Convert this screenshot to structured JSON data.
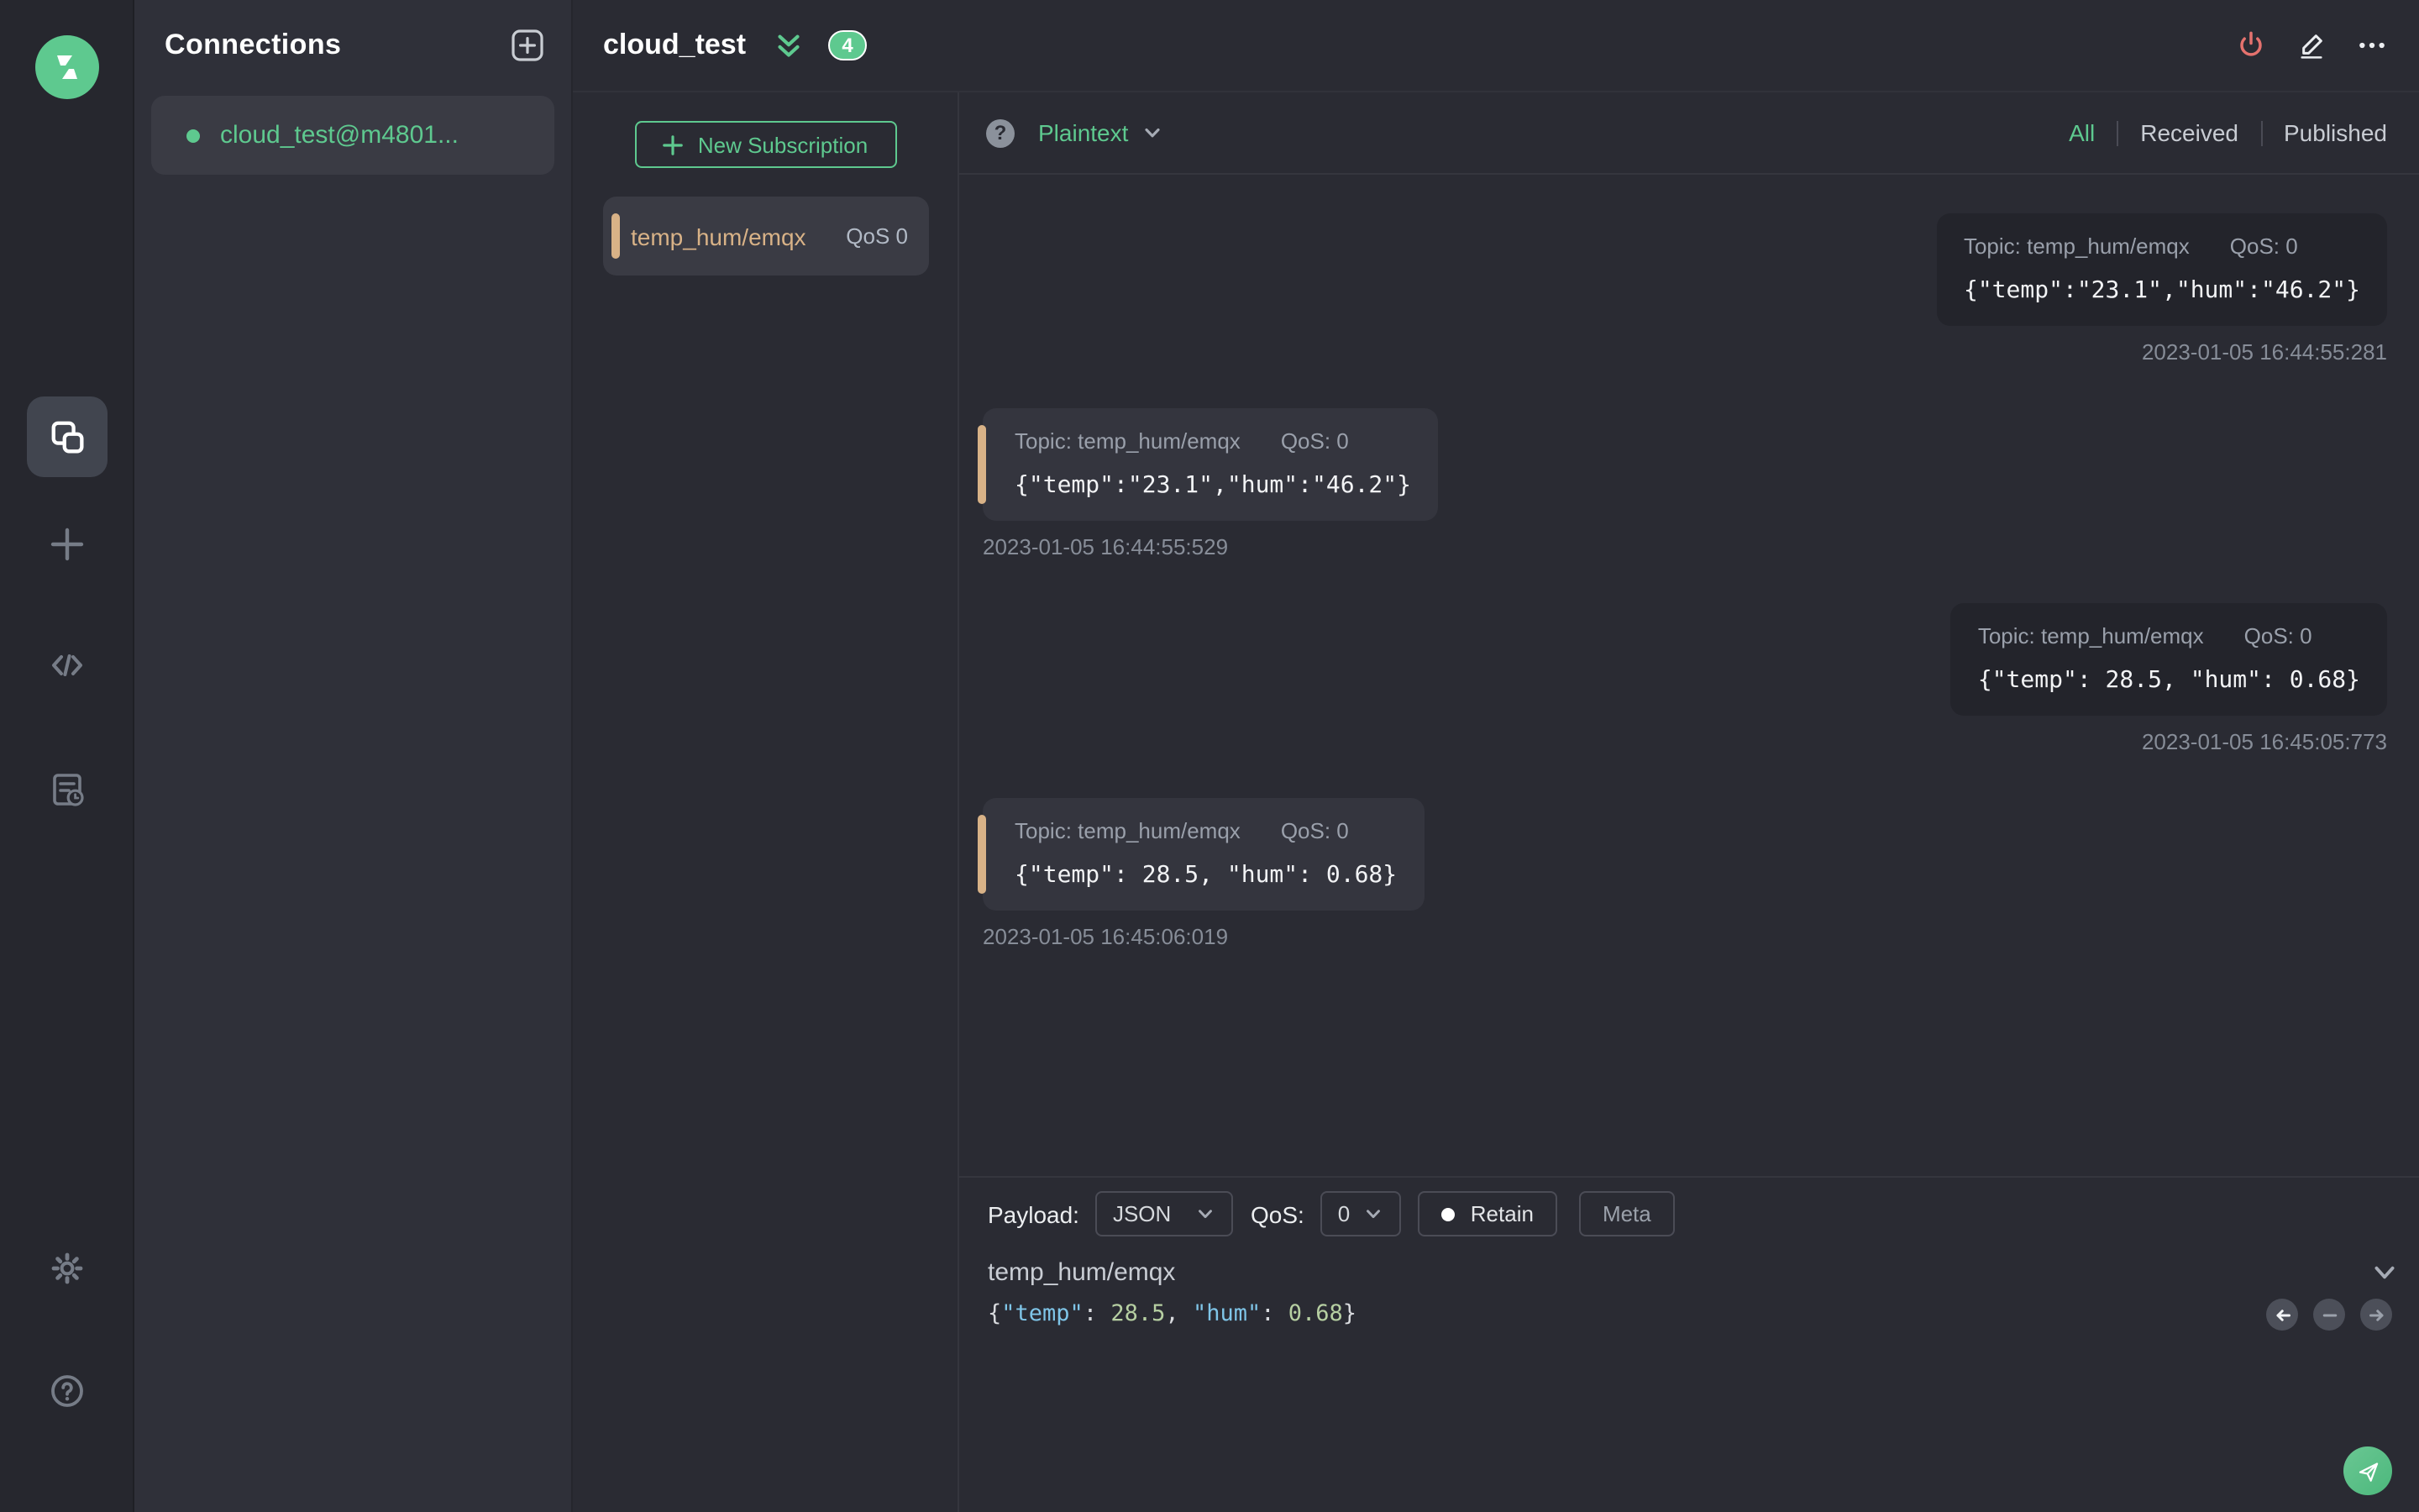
{
  "colors": {
    "accent_green": "#5ec98f",
    "topic_orange": "#d8b287",
    "power_red": "#e5726e"
  },
  "sidebar": {
    "icons": [
      "mqttx-logo",
      "connections",
      "new-connection",
      "script",
      "log",
      "settings",
      "help"
    ]
  },
  "connections": {
    "title": "Connections",
    "items": [
      {
        "label": "cloud_test@m4801...",
        "connected": true
      }
    ]
  },
  "header": {
    "title": "cloud_test",
    "unread_badge": "4"
  },
  "subscriptions": {
    "new_button_label": "New Subscription",
    "items": [
      {
        "topic": "temp_hum/emqx",
        "qos": "QoS 0"
      }
    ]
  },
  "messages": {
    "format": "Plaintext",
    "help_glyph": "?",
    "filters": [
      "All",
      "Received",
      "Published"
    ],
    "active_filter": "All",
    "items": [
      {
        "direction": "published",
        "topic": "Topic: temp_hum/emqx",
        "qos": "QoS: 0",
        "payload": "{\"temp\":\"23.1\",\"hum\":\"46.2\"}",
        "timestamp": "2023-01-05 16:44:55:281"
      },
      {
        "direction": "received",
        "topic": "Topic: temp_hum/emqx",
        "qos": "QoS: 0",
        "payload": "{\"temp\":\"23.1\",\"hum\":\"46.2\"}",
        "timestamp": "2023-01-05 16:44:55:529"
      },
      {
        "direction": "published",
        "topic": "Topic: temp_hum/emqx",
        "qos": "QoS: 0",
        "payload": "{\"temp\": 28.5, \"hum\": 0.68}",
        "timestamp": "2023-01-05 16:45:05:773"
      },
      {
        "direction": "received",
        "topic": "Topic: temp_hum/emqx",
        "qos": "QoS: 0",
        "payload": "{\"temp\": 28.5, \"hum\": 0.68}",
        "timestamp": "2023-01-05 16:45:06:019"
      }
    ]
  },
  "publish": {
    "payload_label": "Payload:",
    "format_value": "JSON",
    "qos_label": "QoS:",
    "qos_value": "0",
    "retain_label": "Retain",
    "meta_label": "Meta",
    "topic_value": "temp_hum/emqx",
    "payload_tokens": [
      [
        "{",
        "p"
      ],
      [
        "\"temp\"",
        "k"
      ],
      [
        ": ",
        "p"
      ],
      [
        "28.5",
        "n"
      ],
      [
        ", ",
        "p"
      ],
      [
        "\"hum\"",
        "k"
      ],
      [
        ": ",
        "p"
      ],
      [
        "0.68",
        "n"
      ],
      [
        "}",
        "p"
      ]
    ]
  }
}
